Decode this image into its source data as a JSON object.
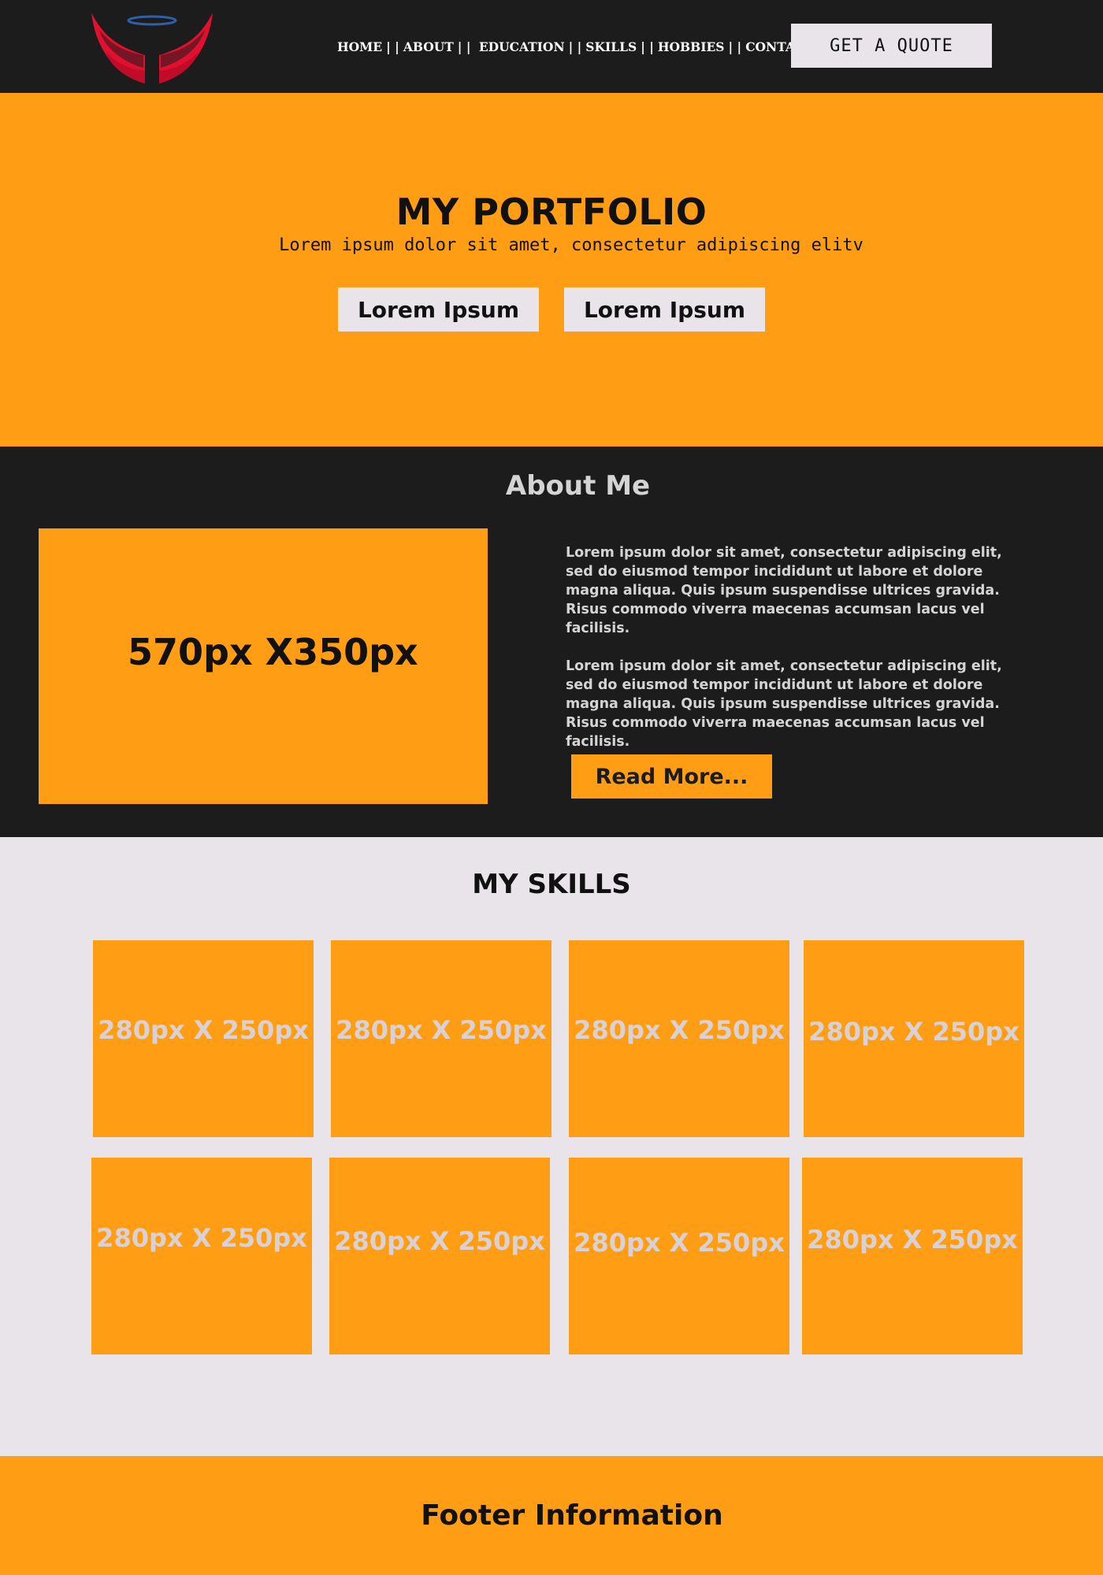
{
  "colors": {
    "header_bg": "#1c1c1c",
    "accent_orange": "#ff9e15",
    "light_bg": "#e8e4ea",
    "logo_red": "#e0102e",
    "logo_halo": "#2f5fa8"
  },
  "header": {
    "logo_icon": "winged-halo-logo",
    "nav": [
      {
        "label": "HOME"
      },
      {
        "label": "ABOUT"
      },
      {
        "label": " EDUCATION"
      },
      {
        "label": "SKILLS"
      },
      {
        "label": "HOBBIES"
      },
      {
        "label": "CONTACT"
      }
    ],
    "nav_separator": "| |",
    "cta_label": "GET A QUOTE"
  },
  "hero": {
    "title": "MY PORTFOLIO",
    "subtitle": "Lorem ipsum dolor sit amet, consectetur adipiscing elitv",
    "buttons": [
      "Lorem Ipsum",
      "Lorem Ipsum"
    ]
  },
  "about": {
    "title": "About Me",
    "image_placeholder": "570px X350px",
    "paragraphs": [
      "Lorem ipsum dolor sit amet, consectetur adipiscing elit, sed do eiusmod tempor incididunt ut labore et dolore magna aliqua. Quis ipsum suspendisse ultrices gravida. Risus commodo viverra maecenas accumsan lacus vel facilisis.",
      "Lorem ipsum dolor sit amet, consectetur adipiscing elit, sed do eiusmod tempor incididunt ut labore et dolore magna aliqua. Quis ipsum suspendisse ultrices gravida. Risus commodo viverra maecenas accumsan lacus vel facilisis."
    ],
    "read_more_label": "Read More..."
  },
  "skills": {
    "title": "MY SKILLS",
    "cards": [
      "280px X 250px",
      "280px X 250px",
      "280px X 250px",
      "280px X 250px",
      "280px X 250px",
      "280px X 250px",
      "280px X 250px",
      "280px X 250px"
    ]
  },
  "footer": {
    "title": "Footer Information"
  }
}
